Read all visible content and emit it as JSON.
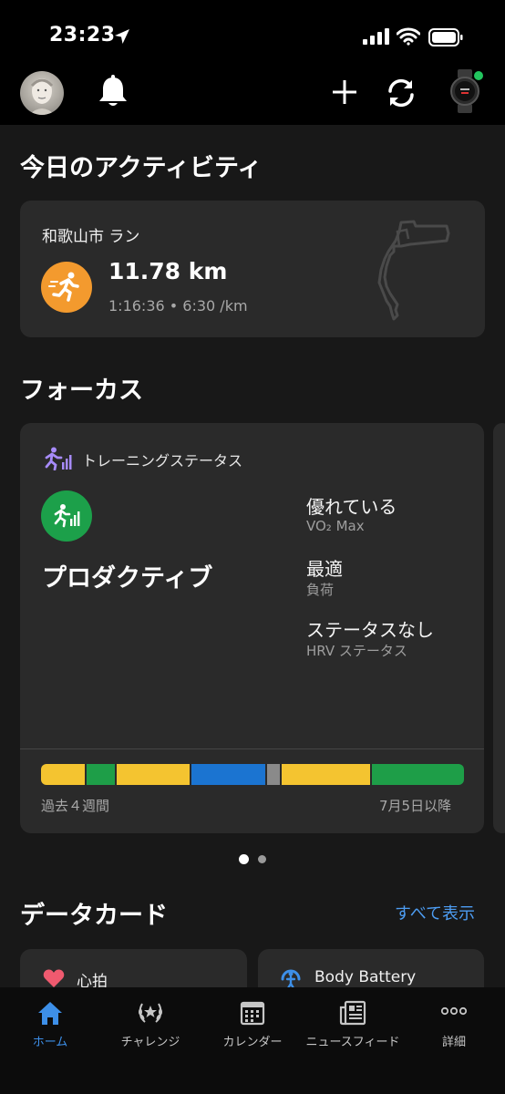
{
  "status_bar": {
    "time": "23:23"
  },
  "activity_section": {
    "title": "今日のアクティビティ",
    "card": {
      "title": "和歌山市 ラン",
      "distance": "11.78 km",
      "details": "1:16:36 • 6:30 /km"
    }
  },
  "focus_section": {
    "title": "フォーカス",
    "card": {
      "header": "トレーニングステータス",
      "status": "プロダクティブ",
      "metrics": [
        {
          "value": "優れている",
          "label": "VO₂ Max"
        },
        {
          "value": "最適",
          "label": "負荷"
        },
        {
          "value": "ステータスなし",
          "label": "HRV ステータス"
        }
      ],
      "period_label": "過去４週間",
      "since_label": "7月5日以降",
      "history_colors": [
        "#f4c430",
        "#1e9e48",
        "#f4c430",
        "#1b74d1",
        "#8a8a8a",
        "#f4c430",
        "#1e9e48"
      ],
      "history_weights": [
        48,
        30,
        80,
        80,
        14,
        97,
        100
      ]
    },
    "pager": {
      "count": 2,
      "active": 0
    }
  },
  "data_cards_section": {
    "title": "データカード",
    "see_all": "すべて表示",
    "cards": [
      {
        "label": "心拍",
        "icon": "heart-icon"
      },
      {
        "label": "Body Battery",
        "icon": "body-battery-icon"
      }
    ]
  },
  "tab_bar": {
    "tabs": [
      {
        "label": "ホーム",
        "icon": "home-icon",
        "active": true
      },
      {
        "label": "チャレンジ",
        "icon": "laurel-icon",
        "active": false
      },
      {
        "label": "カレンダー",
        "icon": "calendar-icon",
        "active": false
      },
      {
        "label": "ニュースフィード",
        "icon": "newsfeed-icon",
        "active": false
      },
      {
        "label": "詳細",
        "icon": "more-icon",
        "active": false
      }
    ]
  },
  "colors": {
    "accent_blue": "#3d8fe8",
    "run_orange": "#f39a2e",
    "status_green": "#1ca04a",
    "heart_red": "#ef5a6f"
  }
}
